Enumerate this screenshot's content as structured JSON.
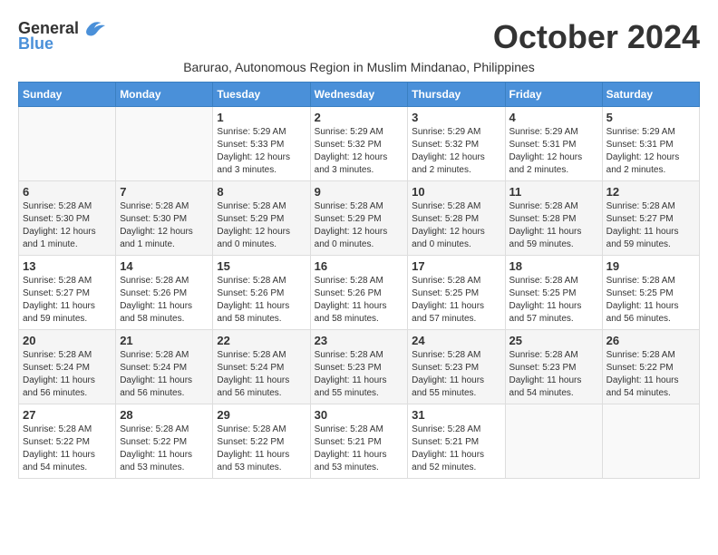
{
  "logo": {
    "general": "General",
    "blue": "Blue"
  },
  "title": "October 2024",
  "subtitle": "Barurao, Autonomous Region in Muslim Mindanao, Philippines",
  "days_header": [
    "Sunday",
    "Monday",
    "Tuesday",
    "Wednesday",
    "Thursday",
    "Friday",
    "Saturday"
  ],
  "weeks": [
    [
      {
        "day": "",
        "info": ""
      },
      {
        "day": "",
        "info": ""
      },
      {
        "day": "1",
        "info": "Sunrise: 5:29 AM\nSunset: 5:33 PM\nDaylight: 12 hours and 3 minutes."
      },
      {
        "day": "2",
        "info": "Sunrise: 5:29 AM\nSunset: 5:32 PM\nDaylight: 12 hours and 3 minutes."
      },
      {
        "day": "3",
        "info": "Sunrise: 5:29 AM\nSunset: 5:32 PM\nDaylight: 12 hours and 2 minutes."
      },
      {
        "day": "4",
        "info": "Sunrise: 5:29 AM\nSunset: 5:31 PM\nDaylight: 12 hours and 2 minutes."
      },
      {
        "day": "5",
        "info": "Sunrise: 5:29 AM\nSunset: 5:31 PM\nDaylight: 12 hours and 2 minutes."
      }
    ],
    [
      {
        "day": "6",
        "info": "Sunrise: 5:28 AM\nSunset: 5:30 PM\nDaylight: 12 hours and 1 minute."
      },
      {
        "day": "7",
        "info": "Sunrise: 5:28 AM\nSunset: 5:30 PM\nDaylight: 12 hours and 1 minute."
      },
      {
        "day": "8",
        "info": "Sunrise: 5:28 AM\nSunset: 5:29 PM\nDaylight: 12 hours and 0 minutes."
      },
      {
        "day": "9",
        "info": "Sunrise: 5:28 AM\nSunset: 5:29 PM\nDaylight: 12 hours and 0 minutes."
      },
      {
        "day": "10",
        "info": "Sunrise: 5:28 AM\nSunset: 5:28 PM\nDaylight: 12 hours and 0 minutes."
      },
      {
        "day": "11",
        "info": "Sunrise: 5:28 AM\nSunset: 5:28 PM\nDaylight: 11 hours and 59 minutes."
      },
      {
        "day": "12",
        "info": "Sunrise: 5:28 AM\nSunset: 5:27 PM\nDaylight: 11 hours and 59 minutes."
      }
    ],
    [
      {
        "day": "13",
        "info": "Sunrise: 5:28 AM\nSunset: 5:27 PM\nDaylight: 11 hours and 59 minutes."
      },
      {
        "day": "14",
        "info": "Sunrise: 5:28 AM\nSunset: 5:26 PM\nDaylight: 11 hours and 58 minutes."
      },
      {
        "day": "15",
        "info": "Sunrise: 5:28 AM\nSunset: 5:26 PM\nDaylight: 11 hours and 58 minutes."
      },
      {
        "day": "16",
        "info": "Sunrise: 5:28 AM\nSunset: 5:26 PM\nDaylight: 11 hours and 58 minutes."
      },
      {
        "day": "17",
        "info": "Sunrise: 5:28 AM\nSunset: 5:25 PM\nDaylight: 11 hours and 57 minutes."
      },
      {
        "day": "18",
        "info": "Sunrise: 5:28 AM\nSunset: 5:25 PM\nDaylight: 11 hours and 57 minutes."
      },
      {
        "day": "19",
        "info": "Sunrise: 5:28 AM\nSunset: 5:25 PM\nDaylight: 11 hours and 56 minutes."
      }
    ],
    [
      {
        "day": "20",
        "info": "Sunrise: 5:28 AM\nSunset: 5:24 PM\nDaylight: 11 hours and 56 minutes."
      },
      {
        "day": "21",
        "info": "Sunrise: 5:28 AM\nSunset: 5:24 PM\nDaylight: 11 hours and 56 minutes."
      },
      {
        "day": "22",
        "info": "Sunrise: 5:28 AM\nSunset: 5:24 PM\nDaylight: 11 hours and 56 minutes."
      },
      {
        "day": "23",
        "info": "Sunrise: 5:28 AM\nSunset: 5:23 PM\nDaylight: 11 hours and 55 minutes."
      },
      {
        "day": "24",
        "info": "Sunrise: 5:28 AM\nSunset: 5:23 PM\nDaylight: 11 hours and 55 minutes."
      },
      {
        "day": "25",
        "info": "Sunrise: 5:28 AM\nSunset: 5:23 PM\nDaylight: 11 hours and 54 minutes."
      },
      {
        "day": "26",
        "info": "Sunrise: 5:28 AM\nSunset: 5:22 PM\nDaylight: 11 hours and 54 minutes."
      }
    ],
    [
      {
        "day": "27",
        "info": "Sunrise: 5:28 AM\nSunset: 5:22 PM\nDaylight: 11 hours and 54 minutes."
      },
      {
        "day": "28",
        "info": "Sunrise: 5:28 AM\nSunset: 5:22 PM\nDaylight: 11 hours and 53 minutes."
      },
      {
        "day": "29",
        "info": "Sunrise: 5:28 AM\nSunset: 5:22 PM\nDaylight: 11 hours and 53 minutes."
      },
      {
        "day": "30",
        "info": "Sunrise: 5:28 AM\nSunset: 5:21 PM\nDaylight: 11 hours and 53 minutes."
      },
      {
        "day": "31",
        "info": "Sunrise: 5:28 AM\nSunset: 5:21 PM\nDaylight: 11 hours and 52 minutes."
      },
      {
        "day": "",
        "info": ""
      },
      {
        "day": "",
        "info": ""
      }
    ]
  ]
}
